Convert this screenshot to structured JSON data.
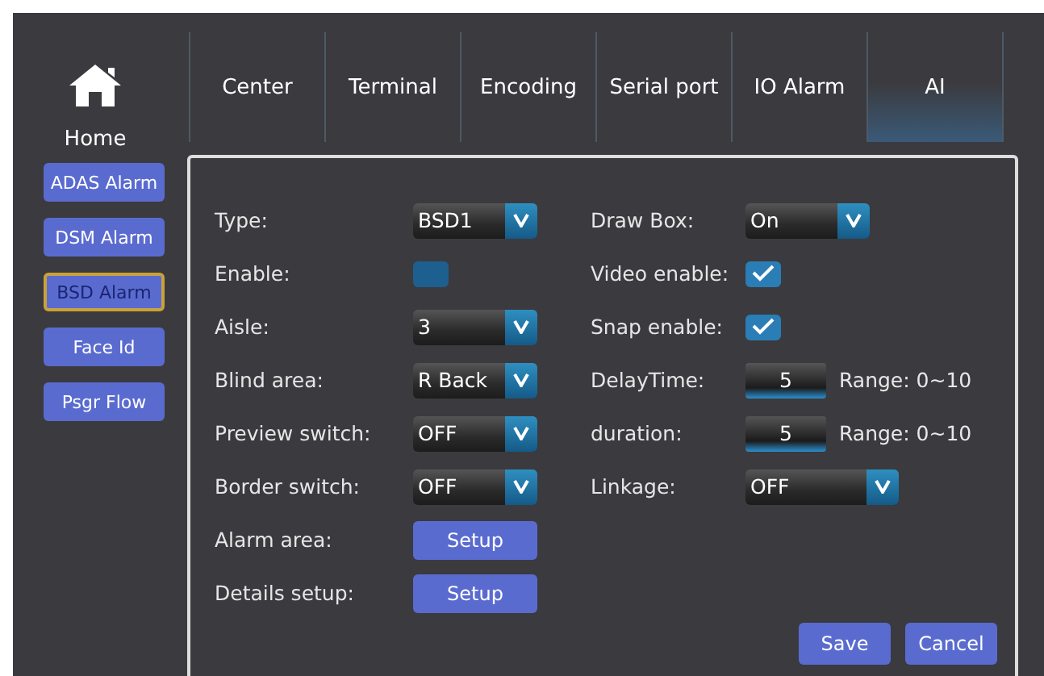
{
  "home": {
    "label": "Home"
  },
  "tabs": [
    {
      "label": "Center",
      "selected": false
    },
    {
      "label": "Terminal",
      "selected": false
    },
    {
      "label": "Encoding",
      "selected": false
    },
    {
      "label": "Serial port",
      "selected": false
    },
    {
      "label": "IO Alarm",
      "selected": false
    },
    {
      "label": "AI",
      "selected": true
    }
  ],
  "sidebar": [
    {
      "label": "ADAS Alarm",
      "selected": false
    },
    {
      "label": "DSM Alarm",
      "selected": false
    },
    {
      "label": "BSD Alarm",
      "selected": true
    },
    {
      "label": "Face Id",
      "selected": false
    },
    {
      "label": "Psgr Flow",
      "selected": false
    }
  ],
  "left_fields": [
    {
      "kind": "dropdown",
      "label": "Type:",
      "value": "BSD1"
    },
    {
      "kind": "checkbox",
      "label": "Enable:",
      "checked": false
    },
    {
      "kind": "dropdown",
      "label": "Aisle:",
      "value": "3"
    },
    {
      "kind": "dropdown",
      "label": "Blind area:",
      "value": "R Back"
    },
    {
      "kind": "dropdown",
      "label": "Preview switch:",
      "value": "OFF"
    },
    {
      "kind": "dropdown",
      "label": "Border switch:",
      "value": "OFF"
    },
    {
      "kind": "button",
      "label": "Alarm area:",
      "value": "Setup"
    },
    {
      "kind": "button",
      "label": "Details setup:",
      "value": "Setup"
    }
  ],
  "right_fields": [
    {
      "kind": "dropdown",
      "label": "Draw Box:",
      "value": "On"
    },
    {
      "kind": "checkbox",
      "label": "Video enable:",
      "checked": true
    },
    {
      "kind": "checkbox",
      "label": "Snap enable:",
      "checked": true
    },
    {
      "kind": "number",
      "label": "DelayTime:",
      "value": "5",
      "range": "Range: 0~10"
    },
    {
      "kind": "number",
      "label": "duration:",
      "value": "5",
      "range": "Range: 0~10"
    },
    {
      "kind": "wide-dropdown",
      "label": "Linkage:",
      "value": "OFF"
    }
  ],
  "buttons": [
    "Save",
    "Cancel"
  ]
}
